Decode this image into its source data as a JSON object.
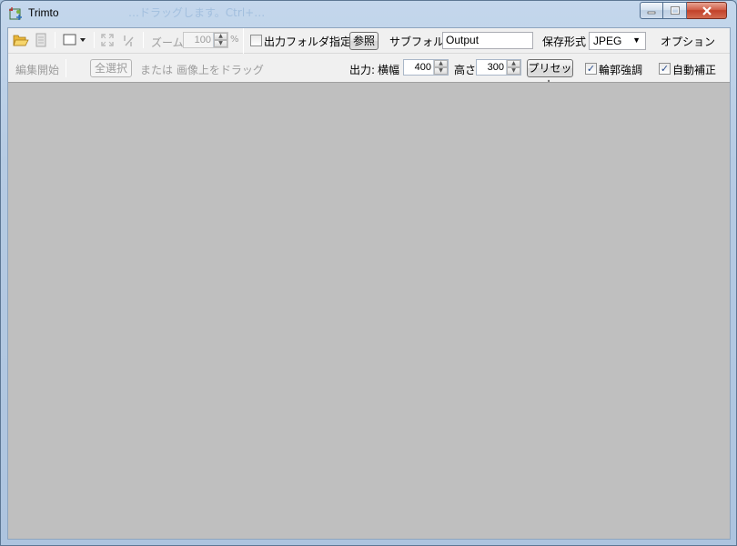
{
  "window": {
    "title": "Trimto",
    "ghost_title": "…ドラッグします。Ctrl+…"
  },
  "toolbar1": {
    "zoom_label": "ズーム",
    "zoom_value": "100",
    "zoom_unit": "%",
    "output_folder_checkbox_label": "出力フォルダ指定",
    "output_folder_checked": false,
    "browse_button": "参照",
    "subfolder_label": "サブフォルダ",
    "subfolder_value": "Output",
    "format_label": "保存形式",
    "format_value": "JPEG",
    "options_label": "オプション"
  },
  "toolbar2": {
    "edit_start_label": "編集開始",
    "select_all_button": "全選択",
    "or_drag_text": "または 画像上をドラッグ",
    "output_label": "出力:",
    "width_label": "横幅",
    "width_value": "400",
    "height_label": "高さ",
    "height_value": "300",
    "preset_button": "プリセット",
    "edge_enhance_label": "輪郭強調",
    "edge_enhance_checked": true,
    "auto_correct_label": "自動補正",
    "auto_correct_checked": true
  },
  "icons": {
    "open": "folder-open-icon",
    "page": "page-icon",
    "frame": "frame-icon",
    "fit": "fit-icon",
    "ratio": "ratio-icon"
  },
  "colors": {
    "canvas": "#bfbfbf",
    "toolbar": "#f0f0f0",
    "close_button": "#c8462f"
  }
}
